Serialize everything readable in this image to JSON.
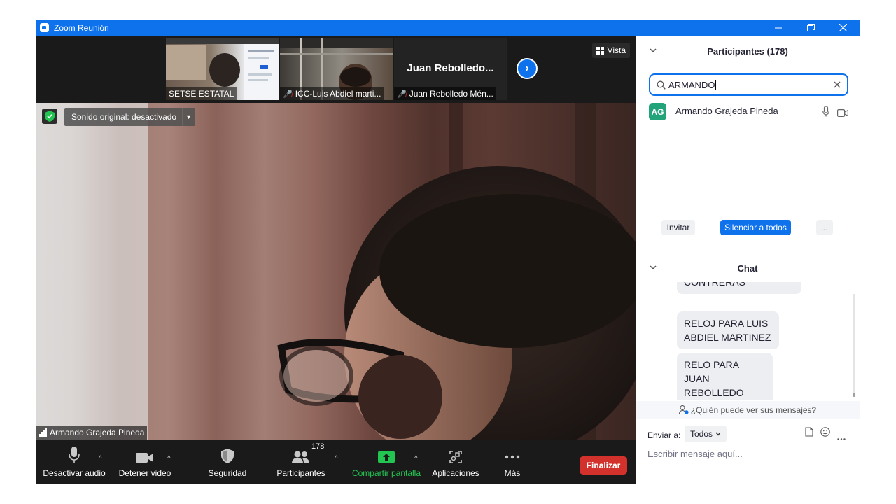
{
  "window": {
    "title": "Zoom Reunión"
  },
  "gallery": {
    "thumbs": [
      {
        "name": "SETSE ESTATAL",
        "muted": false
      },
      {
        "name": "ICC-Luis Abdiel marti...",
        "muted": true
      },
      {
        "name": "Juan Rebolledo Mén...",
        "muted": true,
        "display_name": "Juan  Rebolledo..."
      }
    ],
    "view_label": "Vista"
  },
  "main_video": {
    "sound_label": "Sonido original: desactivado",
    "speaker_name": "Armando Grajeda Pineda"
  },
  "toolbar": {
    "mute_label": "Desactivar audio",
    "video_label": "Detener video",
    "security_label": "Seguridad",
    "participants_label": "Participantes",
    "participants_count": "178",
    "share_label": "Compartir pantalla",
    "apps_label": "Aplicaciones",
    "more_label": "Más",
    "end_label": "Finalizar"
  },
  "participants": {
    "header": "Participantes (178)",
    "search_value": "ARMANDO",
    "list": [
      {
        "initials": "AG",
        "name": "Armando Grajeda Pineda"
      }
    ],
    "invite_label": "Invitar",
    "mute_all_label": "Silenciar a todos",
    "more_label": "..."
  },
  "chat": {
    "header": "Chat",
    "messages": [
      {
        "text": "CONTRERAS"
      },
      {
        "text": "RELOJ PARA LUIS ABDIEL MARTINEZ"
      },
      {
        "text": "RELO PARA JUAN REBOLLEDO"
      }
    ],
    "who_can_see": "¿Quién puede ver sus mensajes?",
    "send_to_label": "Enviar a:",
    "send_to_value": "Todos",
    "input_placeholder": "Escribir mensaje aquí..."
  },
  "colors": {
    "accent": "#0e72ed",
    "end": "#d3322c",
    "share": "#23c552",
    "avatar": "#23a37a"
  }
}
